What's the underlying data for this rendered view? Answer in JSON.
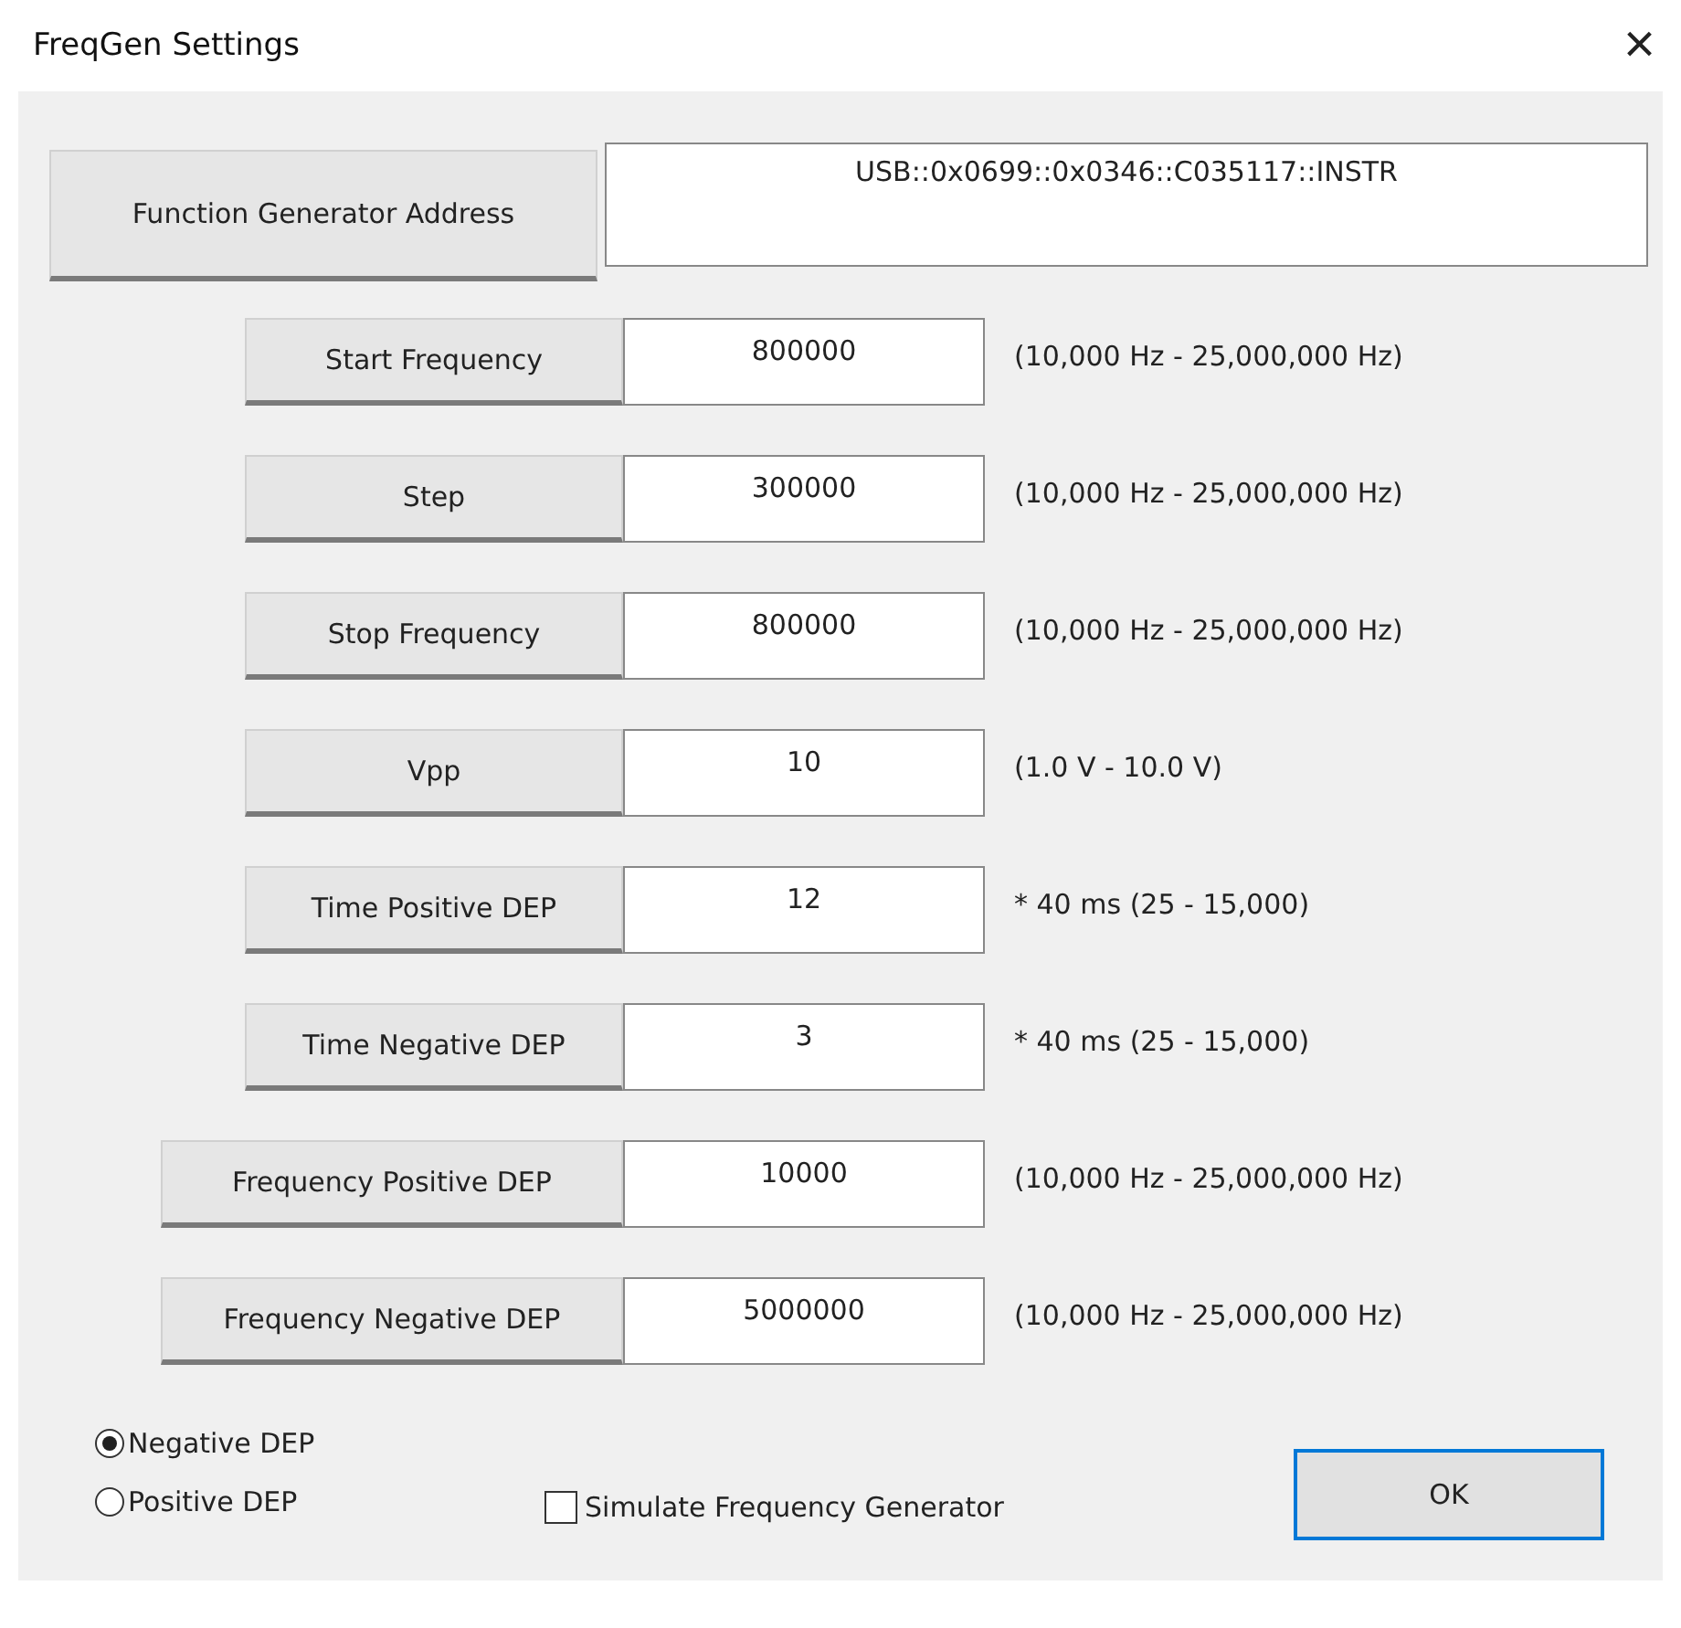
{
  "window": {
    "title": "FreqGen Settings",
    "close": "×"
  },
  "address": {
    "label": "Function Generator Address",
    "value": "USB::0x0699::0x0346::C035117::INSTR"
  },
  "fields": [
    {
      "label": "Start Frequency",
      "value": "800000",
      "hint": "(10,000 Hz - 25,000,000 Hz)",
      "kind": "narrow"
    },
    {
      "label": "Step",
      "value": "300000",
      "hint": "(10,000 Hz - 25,000,000 Hz)",
      "kind": "narrow"
    },
    {
      "label": "Stop Frequency",
      "value": "800000",
      "hint": "(10,000 Hz - 25,000,000 Hz)",
      "kind": "narrow"
    },
    {
      "label": "Vpp",
      "value": "10",
      "hint": "(1.0 V - 10.0 V)",
      "kind": "narrow"
    },
    {
      "label": "Time Positive DEP",
      "value": "12",
      "hint": "* 40 ms (25 - 15,000)",
      "kind": "narrow"
    },
    {
      "label": "Time Negative DEP",
      "value": "3",
      "hint": "* 40 ms (25 - 15,000)",
      "kind": "narrow"
    },
    {
      "label": "Frequency Positive DEP",
      "value": "10000",
      "hint": "(10,000 Hz - 25,000,000 Hz)",
      "kind": "wide"
    },
    {
      "label": "Frequency Negative DEP",
      "value": "5000000",
      "hint": "(10,000 Hz - 25,000,000 Hz)",
      "kind": "wide"
    }
  ],
  "mode": [
    {
      "label": "Negative DEP",
      "selected": true
    },
    {
      "label": "Positive DEP",
      "selected": false
    }
  ],
  "simulate": {
    "label": "Simulate Frequency Generator",
    "checked": false
  },
  "ok_button": "OK"
}
